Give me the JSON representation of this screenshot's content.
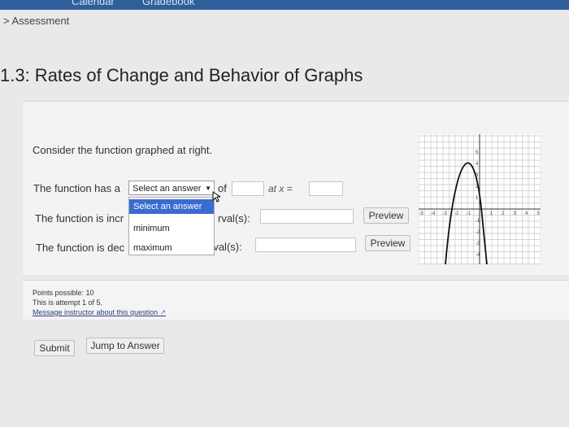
{
  "topnav": {
    "left_label": "Calendar",
    "right_label": "Gradebook"
  },
  "breadcrumb": "> Assessment",
  "page_title": "1.3: Rates of Change and Behavior of Graphs",
  "question": {
    "prompt": "Consider the function graphed at right.",
    "row1": {
      "prefix": "The function has a",
      "select_value": "Select an answer",
      "of": "of",
      "at_x": "at x ="
    },
    "dropdown_options": [
      "Select an answer",
      "minimum",
      "maximum"
    ],
    "row2": {
      "prefix": "The function is incr",
      "suffix": "rval(s):",
      "preview": "Preview"
    },
    "row3": {
      "prefix": "The function is dec",
      "suffix": "rval(s):",
      "preview": "Preview"
    }
  },
  "graph": {
    "x_ticks": [
      "-5",
      "-4",
      "-3",
      "-2",
      "-1",
      "1",
      "2",
      "3",
      "4",
      "5"
    ],
    "y_ticks": [
      "5",
      "4",
      "3",
      "2",
      "1",
      "-1",
      "-2",
      "-3",
      "-4",
      "-5"
    ]
  },
  "footer": {
    "points": "Points possible: 10",
    "attempt": "This is attempt 1 of 5.",
    "message_link": "Message instructor about this question"
  },
  "buttons": {
    "submit": "Submit",
    "jump": "Jump to Answer"
  }
}
